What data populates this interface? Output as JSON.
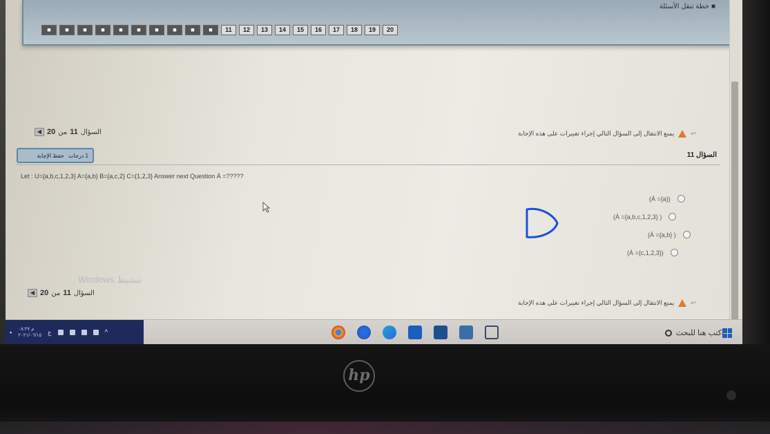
{
  "nav": {
    "title": "■ خطة تنقل الأسئلة",
    "answered_count": 10,
    "buttons": [
      "11",
      "12",
      "13",
      "14",
      "15",
      "16",
      "17",
      "18",
      "19",
      "20"
    ]
  },
  "page_counter_top": {
    "prefix": "السؤال",
    "current": "11",
    "sep": "من",
    "total": "20"
  },
  "page_counter_bottom": {
    "prefix": "السؤال",
    "current": "11",
    "sep": "من",
    "total": "20"
  },
  "warning_text": "يمنع الانتقال إلى السؤال التالي إجراء تغييرات على هذه الإجابة",
  "question": {
    "title": "السؤال 11",
    "marks": "1 درجات",
    "save_label": "حفظ الإجابة",
    "text": "Let : U={a,b,c,1,2,3} A={a,b} B={a,c,2} C={1,2,3} Answer next Question Á =?????"
  },
  "options": [
    "(Á ={a})",
    "(Á ={a,b,c,1,2,3} )",
    "(Á ={a,b} )",
    "(Á ={c,1,2,3})"
  ],
  "watermark": "Windows تنشيط",
  "taskbar": {
    "time": "م ٠٨:٢٧",
    "date": "٢٠٢١/٠٦/١٥",
    "search_placeholder": "اكتب هنا للبحث"
  },
  "colors": {
    "ink": "#1a4fe0",
    "nav_panel": "#aab9c4",
    "warning": "#e07a2a",
    "taskbar_tray": "#1d2a5a"
  }
}
